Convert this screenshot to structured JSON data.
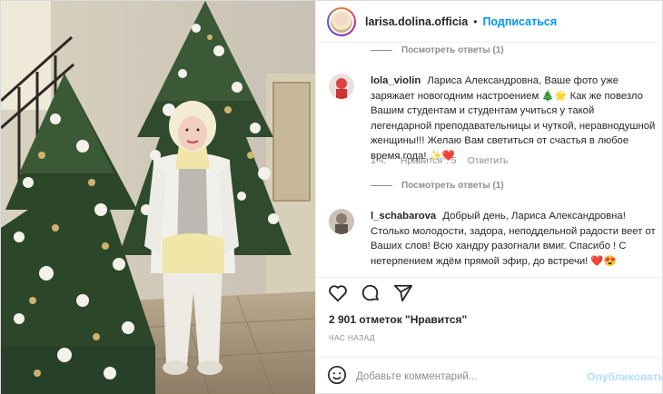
{
  "header": {
    "username": "larisa.dolina.officia",
    "separator": "•",
    "follow_label": "Подписаться"
  },
  "comments": {
    "view_replies_top": "Посмотреть ответы (1)",
    "items": [
      {
        "user": "lola_violin",
        "text": "Лариса Александровна, Ваше фото уже заряжает новогодним настроением 🎄🌟 Как же повезло Вашим студентам и студентам учиться у такой легендарной преподавательницы и чуткой, неравнодушной женщины!!! Желаю Вам светиться от счастья в любое время года! ✨❤️",
        "time": "1 ч.",
        "likes": "\"Нравится\": 5",
        "reply": "Ответить"
      },
      {
        "user": "l_schabarova",
        "text": "Добрый день, Лариса Александровна! Столько молодости, задора, неподдельной радости веет от Ваших слов! Всю хандру разогнали вмиг. Спасибо ! С нетерпением ждём прямой эфир, до встречи! ❤️😍"
      }
    ],
    "view_replies_mid": "Посмотреть ответы (1)"
  },
  "actions": {
    "like_icon": "heart-icon",
    "comment_icon": "comment-icon",
    "share_icon": "share-icon"
  },
  "likes_text": "2 901 отметок \"Нравится\"",
  "time_text": "ЧАС НАЗАД",
  "add_comment": {
    "emoji_icon": "smile-icon",
    "placeholder": "Добавьте комментарий...",
    "publish_label": "Опубликовать"
  },
  "colors": {
    "accent": "#0095f6",
    "muted": "#8e8e8e",
    "publish_disabled": "#b2dffc",
    "text": "#262626"
  }
}
